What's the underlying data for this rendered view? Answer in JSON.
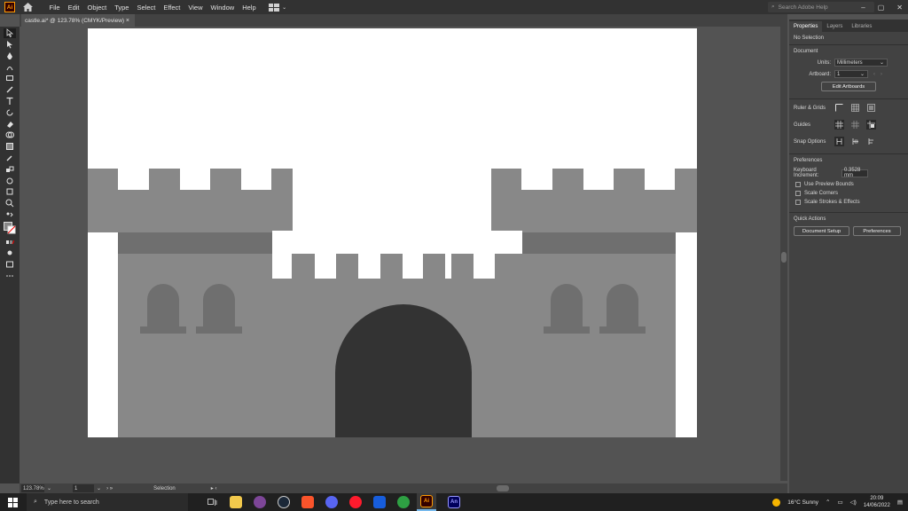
{
  "app": {
    "logo": "Ai"
  },
  "menu": [
    "File",
    "Edit",
    "Object",
    "Type",
    "Select",
    "Effect",
    "View",
    "Window",
    "Help"
  ],
  "search": {
    "placeholder": "Search Adobe Help"
  },
  "window_controls": [
    "–",
    "▢",
    "✕"
  ],
  "document": {
    "tab_title": "castle.ai* @ 123.78% (CMYK/Preview)",
    "close": "×"
  },
  "status": {
    "zoom": "123.78%",
    "artboard": "1",
    "tool": "Selection"
  },
  "panel": {
    "tabs": [
      "Properties",
      "Layers",
      "Libraries"
    ],
    "selection": "No Selection",
    "document_title": "Document",
    "units_label": "Units:",
    "units_value": "Millimeters",
    "artboard_label": "Artboard:",
    "artboard_value": "1",
    "edit_artboards": "Edit Artboards",
    "rulers_grids": "Ruler & Grids",
    "guides": "Guides",
    "snap_options": "Snap Options",
    "preferences_title": "Preferences",
    "keyboard_increment_label": "Keyboard Increment:",
    "keyboard_increment_value": "0.3528 mm",
    "checks": [
      "Use Preview Bounds",
      "Scale Corners",
      "Scale Strokes & Effects"
    ],
    "quick_actions": "Quick Actions",
    "document_setup": "Document Setup",
    "preferences_button": "Preferences"
  },
  "artwork": {
    "colors": {
      "wall": "#888888",
      "wall_dark": "#6f6f6f",
      "door": "#333333",
      "artboard": "#ffffff"
    }
  },
  "taskbar": {
    "search_placeholder": "Type here to search",
    "apps": [
      "task-view",
      "file-explorer",
      "tor",
      "steam",
      "brave",
      "discord",
      "opera",
      "bitwarden",
      "xbox",
      "Ai",
      "An"
    ],
    "weather": "16°C  Sunny",
    "time": "20:09",
    "date": "14/06/2022"
  }
}
